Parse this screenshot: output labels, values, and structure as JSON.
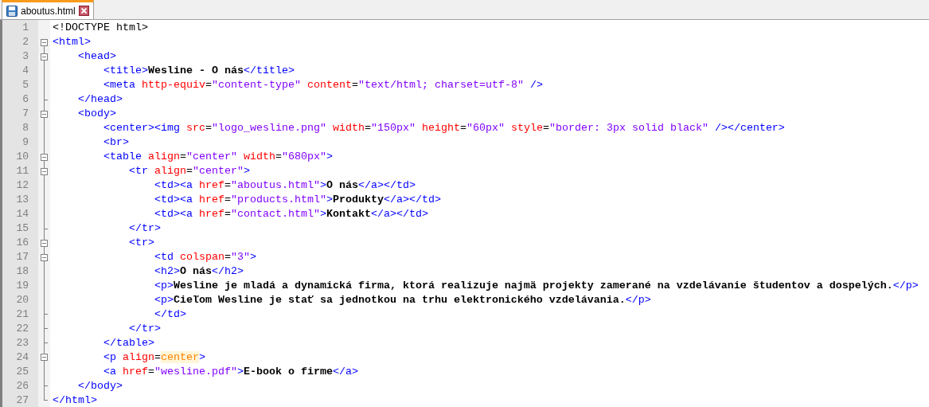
{
  "tabs": [
    {
      "label": "aboutus.html",
      "selected": true
    }
  ],
  "lines": [
    {
      "number": "1",
      "collapsible": false,
      "fold_end": false,
      "tokens": [
        {
          "kind": "plain",
          "text": "<!DOCTYPE html>"
        }
      ]
    },
    {
      "number": "2",
      "collapsible": true,
      "fold_end": false,
      "tokens": [
        {
          "kind": "tag",
          "text": "<html>"
        }
      ]
    },
    {
      "number": "3",
      "collapsible": true,
      "fold_end": false,
      "tokens": [
        {
          "kind": "tag",
          "text": "    <head>"
        }
      ]
    },
    {
      "number": "4",
      "collapsible": false,
      "fold_end": false,
      "tokens": [
        {
          "kind": "tag",
          "text": "        <title>"
        },
        {
          "kind": "text",
          "text": "Wesline - O nás"
        },
        {
          "kind": "tag",
          "text": "</title>"
        }
      ]
    },
    {
      "number": "5",
      "collapsible": false,
      "fold_end": false,
      "tokens": [
        {
          "kind": "tag",
          "text": "        <meta "
        },
        {
          "kind": "attr",
          "text": "http-equiv"
        },
        {
          "kind": "plain",
          "text": "="
        },
        {
          "kind": "value",
          "text": "\"content-type\" "
        },
        {
          "kind": "attr",
          "text": "content"
        },
        {
          "kind": "plain",
          "text": "="
        },
        {
          "kind": "value",
          "text": "\"text/html; charset=utf-8\" "
        },
        {
          "kind": "tag",
          "text": "/>"
        }
      ]
    },
    {
      "number": "6",
      "collapsible": false,
      "fold_end": true,
      "tokens": [
        {
          "kind": "tag",
          "text": "    </head>"
        }
      ]
    },
    {
      "number": "7",
      "collapsible": true,
      "fold_end": false,
      "tokens": [
        {
          "kind": "tag",
          "text": "    <body>"
        }
      ]
    },
    {
      "number": "8",
      "collapsible": false,
      "fold_end": false,
      "tokens": [
        {
          "kind": "tag",
          "text": "        <center><img "
        },
        {
          "kind": "attr",
          "text": "src"
        },
        {
          "kind": "plain",
          "text": "="
        },
        {
          "kind": "value",
          "text": "\"logo_wesline.png\" "
        },
        {
          "kind": "attr",
          "text": "width"
        },
        {
          "kind": "plain",
          "text": "="
        },
        {
          "kind": "value",
          "text": "\"150px\" "
        },
        {
          "kind": "attr",
          "text": "height"
        },
        {
          "kind": "plain",
          "text": "="
        },
        {
          "kind": "value",
          "text": "\"60px\" "
        },
        {
          "kind": "attr",
          "text": "style"
        },
        {
          "kind": "plain",
          "text": "="
        },
        {
          "kind": "value",
          "text": "\"border: 3px solid black\" "
        },
        {
          "kind": "tag",
          "text": "/></center>"
        }
      ]
    },
    {
      "number": "9",
      "collapsible": false,
      "fold_end": false,
      "tokens": [
        {
          "kind": "tag",
          "text": "        <br>"
        }
      ]
    },
    {
      "number": "10",
      "collapsible": true,
      "fold_end": false,
      "tokens": [
        {
          "kind": "tag",
          "text": "        <table "
        },
        {
          "kind": "attr",
          "text": "align"
        },
        {
          "kind": "plain",
          "text": "="
        },
        {
          "kind": "value",
          "text": "\"center\" "
        },
        {
          "kind": "attr",
          "text": "width"
        },
        {
          "kind": "plain",
          "text": "="
        },
        {
          "kind": "value",
          "text": "\"680px\""
        },
        {
          "kind": "tag",
          "text": ">"
        }
      ]
    },
    {
      "number": "11",
      "collapsible": true,
      "fold_end": false,
      "tokens": [
        {
          "kind": "tag",
          "text": "            <tr "
        },
        {
          "kind": "attr",
          "text": "align"
        },
        {
          "kind": "plain",
          "text": "="
        },
        {
          "kind": "value",
          "text": "\"center\""
        },
        {
          "kind": "tag",
          "text": ">"
        }
      ]
    },
    {
      "number": "12",
      "collapsible": false,
      "fold_end": false,
      "tokens": [
        {
          "kind": "tag",
          "text": "                <td><a "
        },
        {
          "kind": "attr",
          "text": "href"
        },
        {
          "kind": "plain",
          "text": "="
        },
        {
          "kind": "value",
          "text": "\"aboutus.html\""
        },
        {
          "kind": "tag",
          "text": ">"
        },
        {
          "kind": "text",
          "text": "O nás"
        },
        {
          "kind": "tag",
          "text": "</a></td>"
        }
      ]
    },
    {
      "number": "13",
      "collapsible": false,
      "fold_end": false,
      "tokens": [
        {
          "kind": "tag",
          "text": "                <td><a "
        },
        {
          "kind": "attr",
          "text": "href"
        },
        {
          "kind": "plain",
          "text": "="
        },
        {
          "kind": "value",
          "text": "\"products.html\""
        },
        {
          "kind": "tag",
          "text": ">"
        },
        {
          "kind": "text",
          "text": "Produkty"
        },
        {
          "kind": "tag",
          "text": "</a></td>"
        }
      ]
    },
    {
      "number": "14",
      "collapsible": false,
      "fold_end": false,
      "tokens": [
        {
          "kind": "tag",
          "text": "                <td><a "
        },
        {
          "kind": "attr",
          "text": "href"
        },
        {
          "kind": "plain",
          "text": "="
        },
        {
          "kind": "value",
          "text": "\"contact.html\""
        },
        {
          "kind": "tag",
          "text": ">"
        },
        {
          "kind": "text",
          "text": "Kontakt"
        },
        {
          "kind": "tag",
          "text": "</a></td>"
        }
      ]
    },
    {
      "number": "15",
      "collapsible": false,
      "fold_end": true,
      "tokens": [
        {
          "kind": "tag",
          "text": "            </tr>"
        }
      ]
    },
    {
      "number": "16",
      "collapsible": true,
      "fold_end": false,
      "tokens": [
        {
          "kind": "tag",
          "text": "            <tr>"
        }
      ]
    },
    {
      "number": "17",
      "collapsible": true,
      "fold_end": false,
      "tokens": [
        {
          "kind": "tag",
          "text": "                <td "
        },
        {
          "kind": "attr",
          "text": "colspan"
        },
        {
          "kind": "plain",
          "text": "="
        },
        {
          "kind": "value",
          "text": "\"3\""
        },
        {
          "kind": "tag",
          "text": ">"
        }
      ]
    },
    {
      "number": "18",
      "collapsible": false,
      "fold_end": false,
      "tokens": [
        {
          "kind": "tag",
          "text": "                <h2>"
        },
        {
          "kind": "text",
          "text": "O nás"
        },
        {
          "kind": "tag",
          "text": "</h2>"
        }
      ]
    },
    {
      "number": "19",
      "collapsible": false,
      "fold_end": false,
      "tokens": [
        {
          "kind": "tag",
          "text": "                <p>"
        },
        {
          "kind": "text",
          "text": "Wesline je mladá a dynamická firma, ktorá realizuje najmä projekty zamerané na vzdelávanie študentov a dospelých."
        },
        {
          "kind": "tag",
          "text": "</p>"
        }
      ]
    },
    {
      "number": "20",
      "collapsible": false,
      "fold_end": false,
      "tokens": [
        {
          "kind": "tag",
          "text": "                <p>"
        },
        {
          "kind": "text",
          "text": "Cieľom Wesline je stať sa jednotkou na trhu elektronického vzdelávania."
        },
        {
          "kind": "tag",
          "text": "</p>"
        }
      ]
    },
    {
      "number": "21",
      "collapsible": false,
      "fold_end": true,
      "tokens": [
        {
          "kind": "tag",
          "text": "                </td>"
        }
      ]
    },
    {
      "number": "22",
      "collapsible": false,
      "fold_end": true,
      "tokens": [
        {
          "kind": "tag",
          "text": "            </tr>"
        }
      ]
    },
    {
      "number": "23",
      "collapsible": false,
      "fold_end": true,
      "tokens": [
        {
          "kind": "tag",
          "text": "        </table>"
        }
      ]
    },
    {
      "number": "24",
      "collapsible": true,
      "fold_end": false,
      "tokens": [
        {
          "kind": "tag",
          "text": "        <p "
        },
        {
          "kind": "attr",
          "text": "align"
        },
        {
          "kind": "plain",
          "text": "="
        },
        {
          "kind": "unquoted",
          "text": "center"
        },
        {
          "kind": "tag",
          "text": ">"
        }
      ]
    },
    {
      "number": "25",
      "collapsible": false,
      "fold_end": false,
      "tokens": [
        {
          "kind": "tag",
          "text": "        <a "
        },
        {
          "kind": "attr",
          "text": "href"
        },
        {
          "kind": "plain",
          "text": "="
        },
        {
          "kind": "value",
          "text": "\"wesline.pdf\""
        },
        {
          "kind": "tag",
          "text": ">"
        },
        {
          "kind": "text",
          "text": "E-book o firme"
        },
        {
          "kind": "tag",
          "text": "</a>"
        }
      ]
    },
    {
      "number": "26",
      "collapsible": false,
      "fold_end": true,
      "tokens": [
        {
          "kind": "tag",
          "text": "    </body>"
        }
      ]
    },
    {
      "number": "27",
      "collapsible": false,
      "fold_end": true,
      "tokens": [
        {
          "kind": "tag",
          "text": "</html>"
        }
      ]
    }
  ]
}
